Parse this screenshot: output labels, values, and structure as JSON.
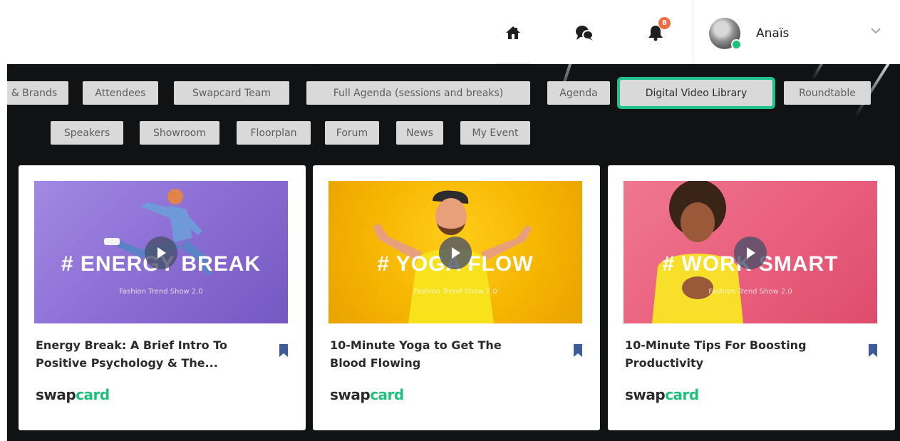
{
  "header": {
    "notification_count": "8",
    "user_name": "Anaïs"
  },
  "tabs_row1": [
    {
      "label": "& Brands"
    },
    {
      "label": "Attendees"
    },
    {
      "label": "Swapcard Team"
    },
    {
      "label": "Full Agenda (sessions and breaks)"
    },
    {
      "label": "Agenda"
    },
    {
      "label": "Digital Video Library",
      "active": true
    },
    {
      "label": "Roundtable"
    }
  ],
  "tabs_row2": [
    {
      "label": "Speakers"
    },
    {
      "label": "Showroom"
    },
    {
      "label": "Floorplan"
    },
    {
      "label": "Forum"
    },
    {
      "label": "News"
    },
    {
      "label": "My Event"
    }
  ],
  "cards": [
    {
      "thumb_title": "# ENERGY BREAK",
      "thumb_subtitle": "Fashion Trend Show 2.0",
      "title_line1": "Energy Break: A Brief Intro To",
      "title_line2": "Positive Psychology & The...",
      "logo_a": "swap",
      "logo_b": "card",
      "bg": "#8f6fd6"
    },
    {
      "thumb_title": "# YOGA FLOW",
      "thumb_subtitle": "Fashion Trend Show 2.0",
      "title_line1": "10-Minute Yoga to Get The",
      "title_line2": "Blood Flowing",
      "logo_a": "swap",
      "logo_b": "card",
      "bg": "#f4b400"
    },
    {
      "thumb_title": "# WORK SMART",
      "thumb_subtitle": "Fashion Trend Show 2.0",
      "title_line1": "10-Minute Tips For Boosting",
      "title_line2": "Productivity",
      "logo_a": "swap",
      "logo_b": "card",
      "bg": "#ea5f7d"
    }
  ],
  "colors": {
    "accent": "#1dc17a",
    "active_outline": "#1ec28b",
    "badge": "#f26a3d",
    "banner_bg": "#111214"
  },
  "icons": [
    "home-icon",
    "chat-icon",
    "bell-icon",
    "chevron-down-icon",
    "play-icon",
    "bookmark-icon"
  ]
}
